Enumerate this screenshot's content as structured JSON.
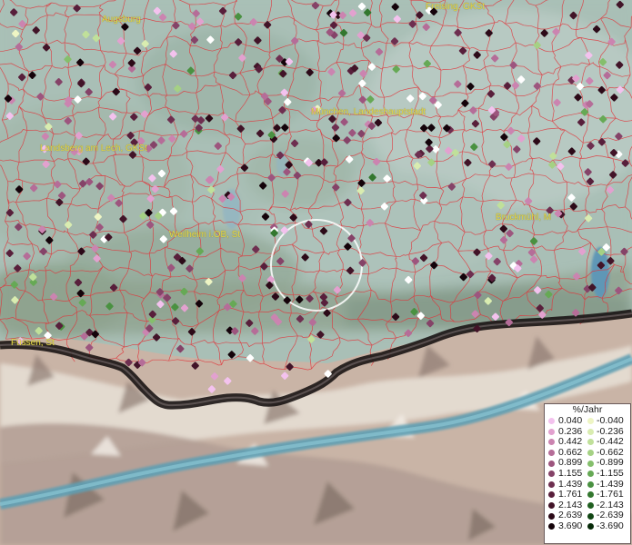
{
  "map": {
    "labels": [
      {
        "text": "Augsburg"
      },
      {
        "text": "Freising, GKSt"
      },
      {
        "text": "München, Landeshauptstadt"
      },
      {
        "text": "Landsberg am Lech, GKSt"
      },
      {
        "text": "Weilheim i.OB, St"
      },
      {
        "text": "Bruckmühl, M"
      },
      {
        "text": "Füssen, St"
      }
    ]
  },
  "legend": {
    "title": "%/Jahr",
    "rows": [
      {
        "pos": "0.040",
        "neg": "-0.040",
        "pos_color": "#f3c2ee",
        "neg_color": "#eef5c4"
      },
      {
        "pos": "0.236",
        "neg": "-0.236",
        "pos_color": "#e2a1cf",
        "neg_color": "#d9ecb0"
      },
      {
        "pos": "0.442",
        "neg": "-0.442",
        "pos_color": "#cb84b0",
        "neg_color": "#c0e09a"
      },
      {
        "pos": "0.662",
        "neg": "-0.662",
        "pos_color": "#b56d98",
        "neg_color": "#a5d184"
      },
      {
        "pos": "0.899",
        "neg": "-0.899",
        "pos_color": "#9d557e",
        "neg_color": "#85bf6c"
      },
      {
        "pos": "1.155",
        "neg": "-1.155",
        "pos_color": "#854368",
        "neg_color": "#66a955"
      },
      {
        "pos": "1.439",
        "neg": "-1.439",
        "pos_color": "#6e2f50",
        "neg_color": "#4a9141"
      },
      {
        "pos": "1.761",
        "neg": "-1.761",
        "pos_color": "#581f3b",
        "neg_color": "#33772f"
      },
      {
        "pos": "2.143",
        "neg": "-2.143",
        "pos_color": "#421428",
        "neg_color": "#205f20"
      },
      {
        "pos": "2.639",
        "neg": "-2.639",
        "pos_color": "#2c0a18",
        "neg_color": "#114613"
      },
      {
        "pos": "3.690",
        "neg": "-3.690",
        "pos_color": "#14030a",
        "neg_color": "#062a08"
      }
    ]
  }
}
